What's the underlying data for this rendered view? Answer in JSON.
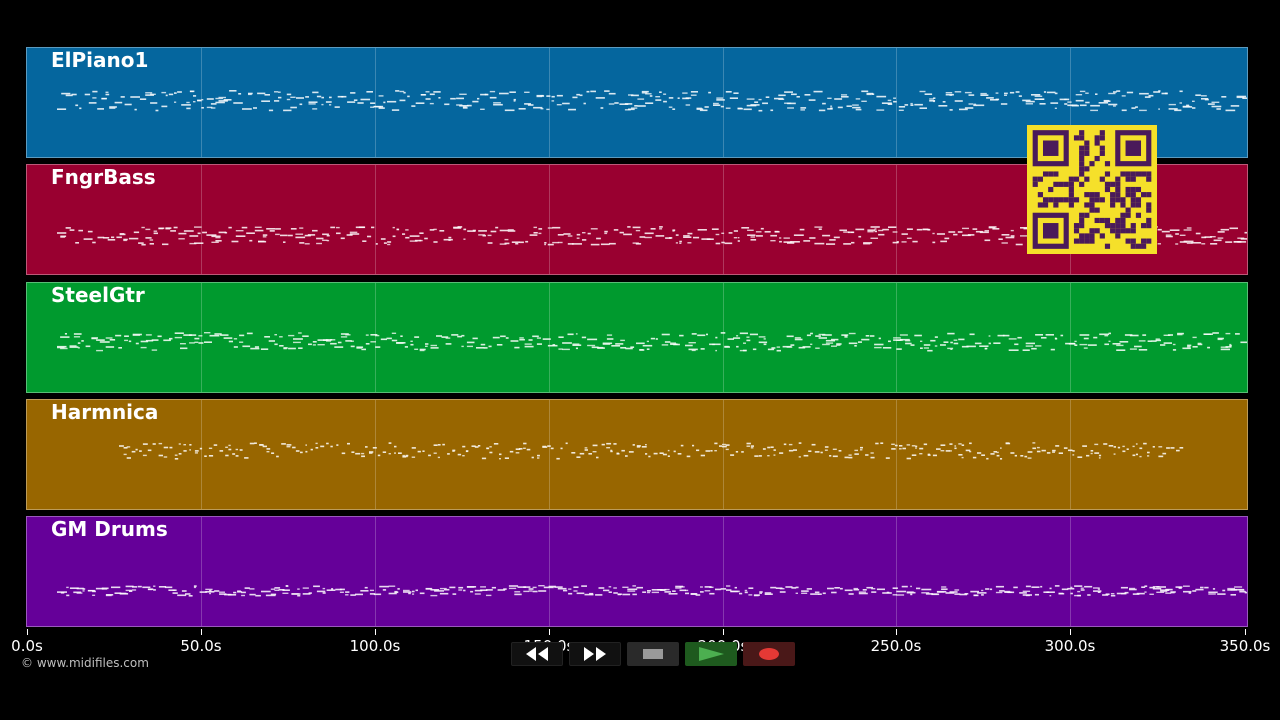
{
  "tracks": [
    {
      "name": "ElPiano1",
      "color": "#05669e"
    },
    {
      "name": "FngrBass",
      "color": "#990030"
    },
    {
      "name": "SteelGtr",
      "color": "#009a2e"
    },
    {
      "name": "Harmnica",
      "color": "#986600"
    },
    {
      "name": "GM Drums",
      "color": "#650099"
    }
  ],
  "axis": {
    "ticks": [
      "0.0s",
      "50.0s",
      "100.0s",
      "150.0s",
      "200.0s",
      "250.0s",
      "300.0s",
      "350.0s"
    ]
  },
  "copyright": "© www.midifiles.com",
  "transport": {
    "rewind_icon": "rewind-icon",
    "fastforward_icon": "fast-forward-icon",
    "stop_icon": "stop-icon",
    "play_icon": "play-icon",
    "record_icon": "record-icon",
    "accent_play": "#4caf50",
    "accent_record": "#e53935"
  },
  "qr": {
    "color": "#f5e02a",
    "module_color": "#4a1a5a"
  }
}
